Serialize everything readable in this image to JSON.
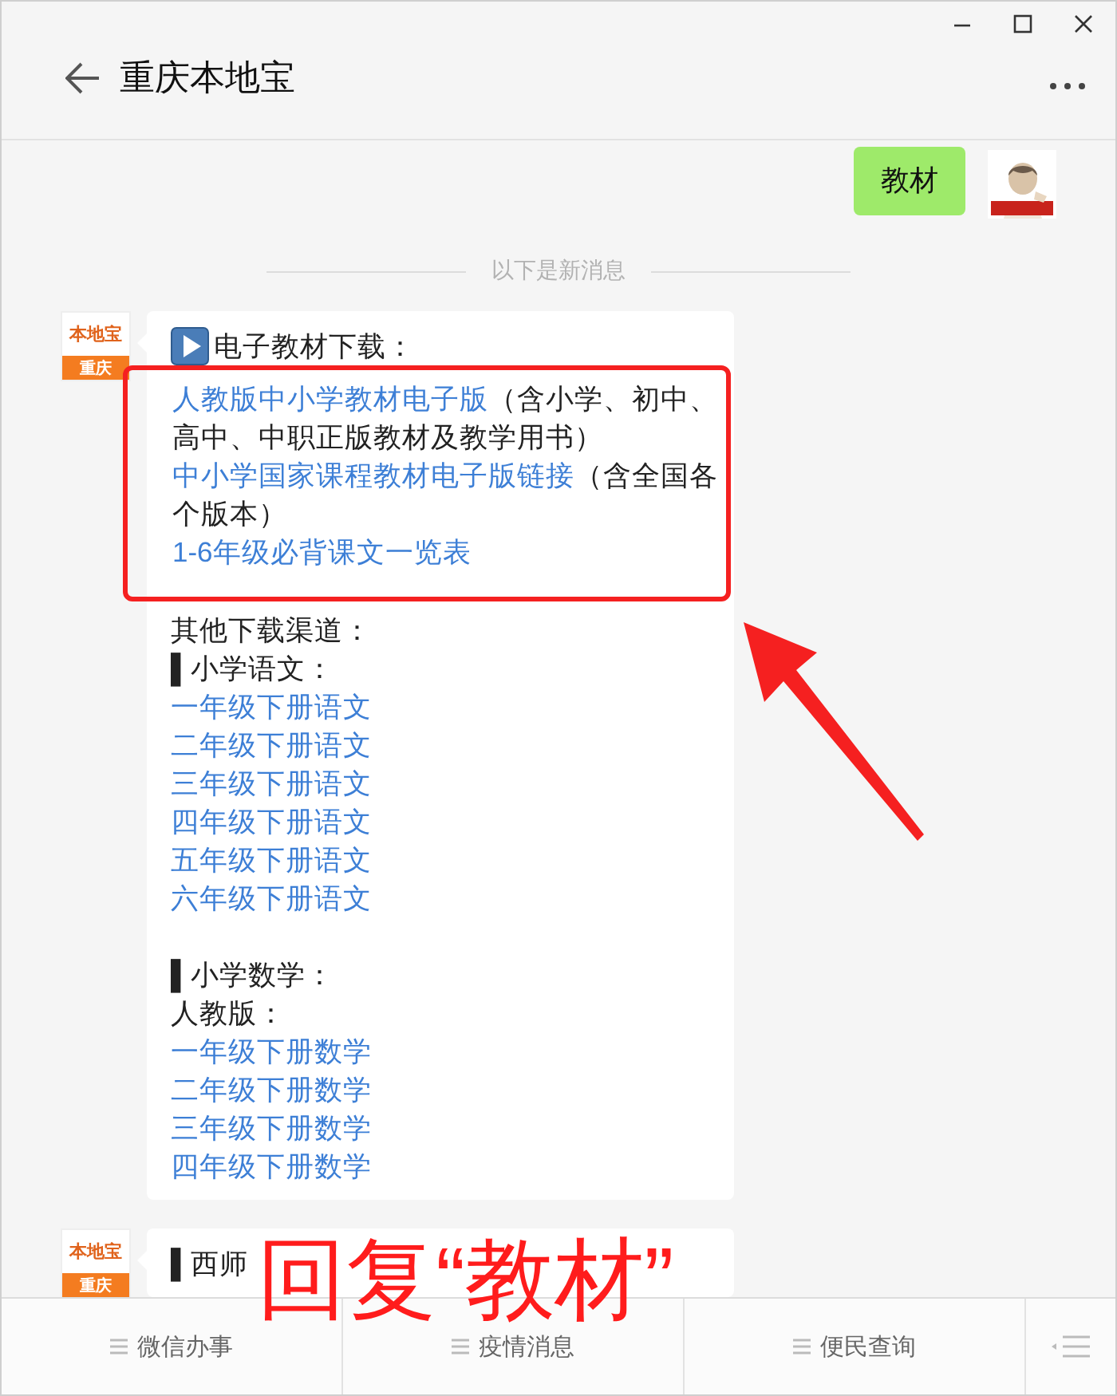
{
  "window": {
    "title": "重庆本地宝"
  },
  "chat": {
    "messages": [
      {
        "kind": "sent",
        "text": "教材"
      },
      {
        "kind": "divider",
        "text": "以下是新消息"
      },
      {
        "kind": "received",
        "avatar": {
          "logo": "本地宝",
          "city": "重庆"
        },
        "blocks": [
          {
            "kind": "heading",
            "text": "电子教材下载："
          },
          {
            "kind": "boxed",
            "lines": [
              {
                "link": "人教版中小学教材电子版",
                "note": "（含小学、初中、高中、中职正版教材及教学用书）"
              },
              {
                "link": "中小学国家课程教材电子版链接",
                "note": "（含全国各个版本）"
              },
              {
                "link": "1-6年级必背课文一览表"
              }
            ]
          },
          {
            "kind": "text",
            "text": "其他下载渠道："
          },
          {
            "kind": "text",
            "text": "▌小学语文："
          },
          {
            "kind": "link",
            "text": "一年级下册语文"
          },
          {
            "kind": "link",
            "text": "二年级下册语文"
          },
          {
            "kind": "link",
            "text": "三年级下册语文"
          },
          {
            "kind": "link",
            "text": "四年级下册语文"
          },
          {
            "kind": "link",
            "text": "五年级下册语文"
          },
          {
            "kind": "link",
            "text": "六年级下册语文"
          },
          {
            "kind": "gap"
          },
          {
            "kind": "text",
            "text": "▌小学数学："
          },
          {
            "kind": "text",
            "text": "人教版："
          },
          {
            "kind": "link",
            "text": "一年级下册数学"
          },
          {
            "kind": "link",
            "text": "二年级下册数学"
          },
          {
            "kind": "link",
            "text": "三年级下册数学"
          },
          {
            "kind": "link",
            "text": "四年级下册数学"
          }
        ]
      },
      {
        "kind": "received",
        "avatar": {
          "logo": "本地宝",
          "city": "重庆"
        },
        "blocks": [
          {
            "kind": "text",
            "text": "▌西师"
          }
        ]
      }
    ]
  },
  "annotation": {
    "text": "回复“教材”"
  },
  "menu": {
    "items": [
      "微信办事",
      "疫情消息",
      "便民查询"
    ]
  }
}
